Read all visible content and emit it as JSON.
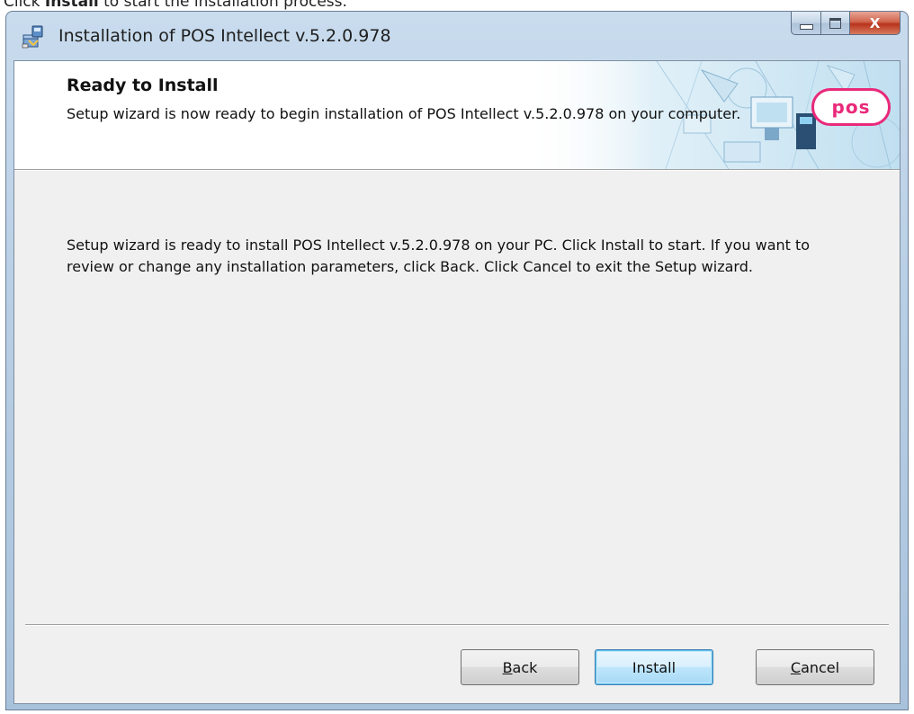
{
  "caption": {
    "prefix": "Click ",
    "bold": "Install",
    "suffix": " to start the installation process."
  },
  "window": {
    "title": "Installation of POS Intellect v.5.2.0.978",
    "app_icon": "installer-package-icon",
    "controls": {
      "minimize_icon": "minimize-icon",
      "maximize_icon": "maximize-icon",
      "close_icon": "close-icon",
      "close_glyph": "X"
    }
  },
  "banner": {
    "title": "Ready to Install",
    "description": "Setup wizard is now ready to begin installation of POS Intellect v.5.2.0.978 on your computer.",
    "logo_text": "pos",
    "logo_color": "#e9297a"
  },
  "body": {
    "text": "Setup wizard is ready to install POS Intellect v.5.2.0.978 on your PC. Click Install to start. If you want to review or change any installation parameters, click Back. Click Cancel to exit the Setup wizard."
  },
  "buttons": {
    "back": {
      "mnemonic": "B",
      "rest": "ack"
    },
    "install": "Install",
    "cancel": {
      "mnemonic": "C",
      "rest": "ancel"
    }
  }
}
